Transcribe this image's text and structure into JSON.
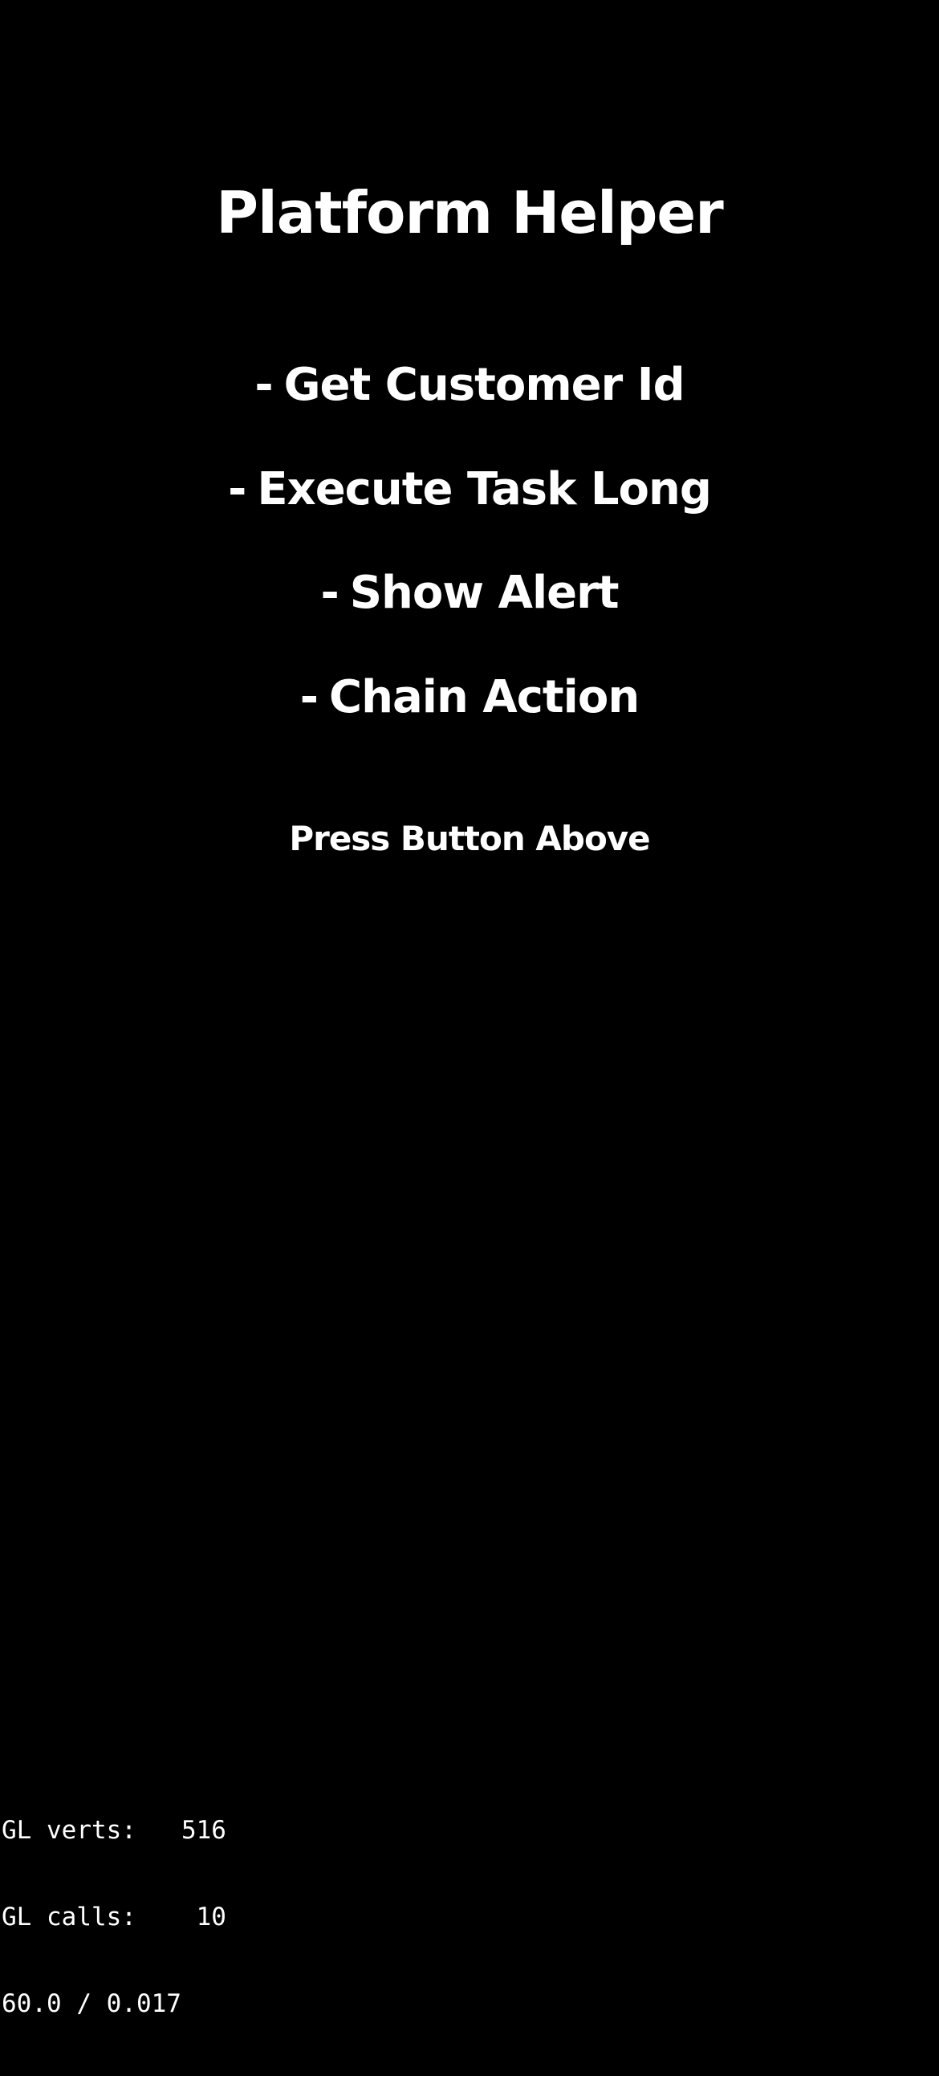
{
  "app": {
    "title": "Platform Helper"
  },
  "menu": {
    "items": [
      {
        "dash": "-",
        "label": "Get Customer Id"
      },
      {
        "dash": "-",
        "label": "Execute Task Long"
      },
      {
        "dash": "-",
        "label": "Show Alert"
      },
      {
        "dash": "-",
        "label": "Chain Action"
      }
    ]
  },
  "status": {
    "text": "Press Button Above"
  },
  "debug_stats": {
    "verts_line": "GL verts:   516",
    "calls_line": "GL calls:    10",
    "fps_line": "60.0 / 0.017"
  },
  "colors": {
    "background": "#000000",
    "text": "#ffffff"
  }
}
